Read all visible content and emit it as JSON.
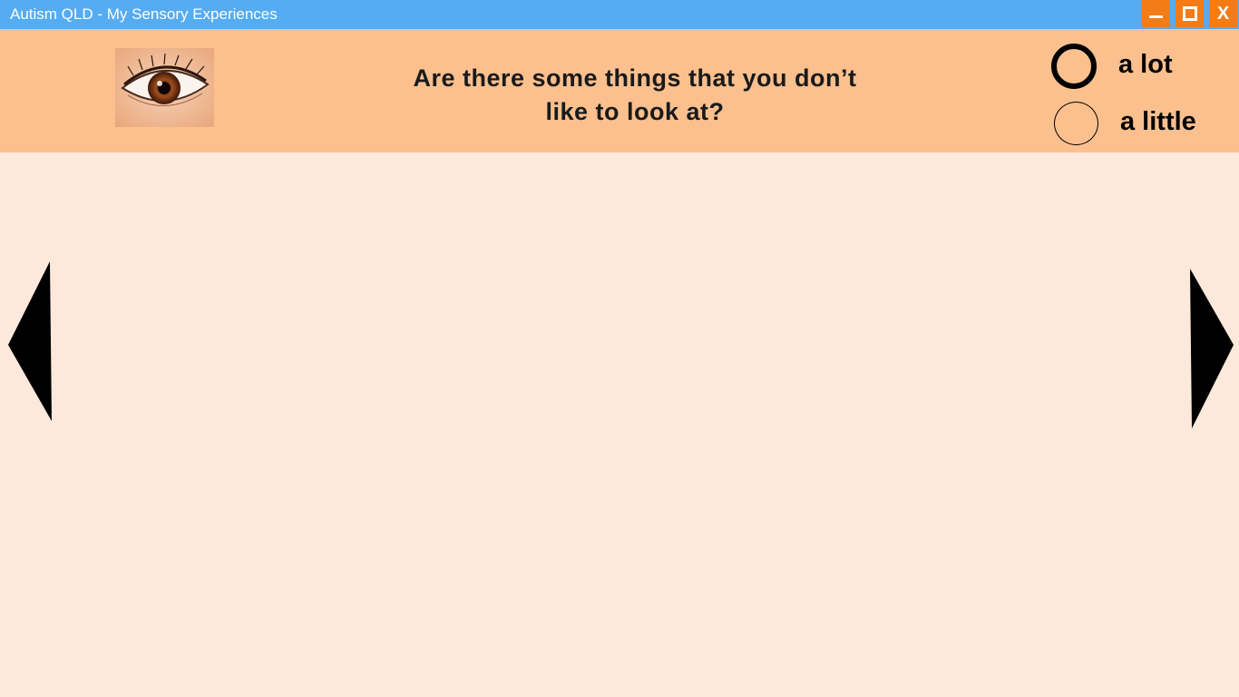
{
  "window": {
    "title": "Autism QLD - My Sensory Experiences",
    "close_label": "X"
  },
  "header": {
    "image_icon": "eye-photo",
    "question": "Are there some things that you don’t like to look at?"
  },
  "options": [
    {
      "label": "a lot",
      "selected": true
    },
    {
      "label": "a little",
      "selected": false
    }
  ],
  "nav": {
    "prev_icon": "triangle-left",
    "next_icon": "triangle-right"
  },
  "colors": {
    "titlebar": "#55acf2",
    "window_buttons": "#f47b16",
    "header": "#fbc08e",
    "background": "#fde9db"
  }
}
